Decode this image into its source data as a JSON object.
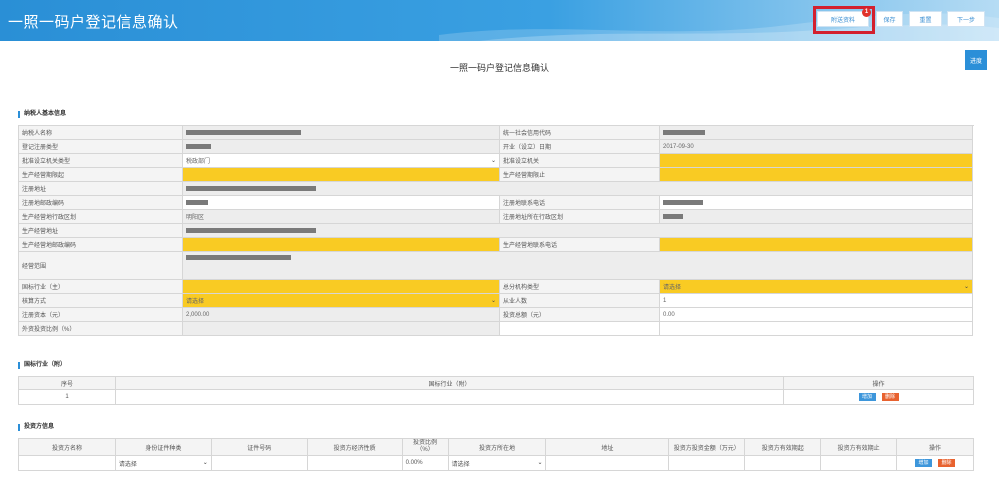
{
  "header": {
    "title": "一照一码户登记信息确认",
    "buttons": {
      "attachment": "附送资料",
      "attachment_badge": "1",
      "save": "保存",
      "reset": "重置",
      "next": "下一步"
    }
  },
  "page_title": "一照一码户登记信息确认",
  "progress_label": "进度",
  "basic_section": {
    "title": "纳税人基本信息",
    "labels": {
      "taxpayer_name": "纳税人名称",
      "credit_code": "统一社会信用代码",
      "reg_type": "登记注册类型",
      "open_date": "开业（设立）日期",
      "approve_org_type": "批准设立机关类型",
      "approve_org": "批准设立机关",
      "biz_start": "生产经营期限起",
      "biz_end": "生产经营期限止",
      "reg_address": "注册地址",
      "reg_postcode": "注册地邮政编码",
      "reg_phone": "注册地联系电话",
      "biz_district": "生产经营地行政区划",
      "reg_district": "注册地址所在行政区划",
      "biz_address": "生产经营地址",
      "biz_postcode": "生产经营地邮政编码",
      "biz_phone": "生产经营地联系电话",
      "scope": "经营范围",
      "industry_main": "国标行业（主）",
      "branch_type": "总分机构类型",
      "accounting": "核算方式",
      "employees": "从业人数",
      "reg_capital": "注册资本（元）",
      "investment": "投资总额（元）",
      "foreign_ratio": "外资投资比例（%）"
    },
    "values": {
      "open_date": "2017-09-30",
      "approve_org_type": "税政部门",
      "biz_district": "明阳区",
      "branch_type": "请选择",
      "accounting": "请选择",
      "employees": "1",
      "reg_capital": "2,000.00",
      "investment": "0.00"
    }
  },
  "industry_section": {
    "title": "国标行业（附）",
    "headers": {
      "no": "序号",
      "industry": "国标行业（附）",
      "ops": "操作"
    },
    "rows": [
      {
        "no": "1",
        "industry": ""
      }
    ],
    "add": "增加",
    "delete": "删除"
  },
  "investor_section": {
    "title": "投资方信息",
    "headers": {
      "name": "投资方名称",
      "id_type": "身份证件种类",
      "id_no": "证件号码",
      "nature": "投资方经济性质",
      "ratio": "投资比例（%）",
      "nationality": "投资方所在地",
      "address": "地址",
      "amount": "投资方投资金额（万元）",
      "valid_from": "投资方有效期起",
      "valid_to": "投资方有效期止",
      "ops": "操作"
    },
    "row": {
      "id_type": "请选择",
      "ratio": "0.00%",
      "nationality": "请选择"
    },
    "add": "增加",
    "delete": "删除"
  },
  "colors": {
    "header_blue": "#2a8fd6",
    "highlight_red": "#d3202e",
    "required_yellow": "#f9cb23",
    "add_blue": "#3d96db",
    "delete_orange": "#e8622f"
  }
}
